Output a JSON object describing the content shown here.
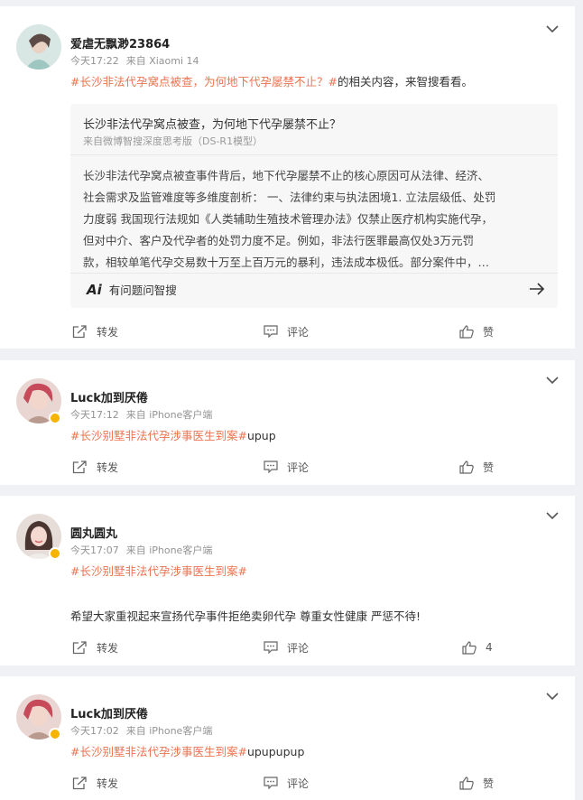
{
  "posts": [
    {
      "username": "爱虐无飘渺23864",
      "time": "今天17:22",
      "source": "来自 Xiaomi 14",
      "hashtag": "#长沙非法代孕窝点被查，为何地下代孕屡禁不止？#",
      "text_after_tag": "的相关内容，来智搜看看。",
      "ai_card": {
        "title": "长沙非法代孕窝点被查，为何地下代孕屡禁不止？",
        "subtitle": "来自微博智搜深度思考版（DS-R1模型）",
        "lines": [
          "长沙非法代孕窝点被查事件背后，地下代孕屡禁不止的核心原因可从法律、经济、",
          "社会需求及监管难度等多维度剖析： 一、法律约束与执法困境1. 立法层级低、处罚",
          "力度弱 我国现行法规如《人类辅助生殖技术管理办法》仅禁止医疗机构实施代孕，",
          "但对中介、客户及代孕者的处罚力度不足。例如，非法行医罪最高仅处3万元罚",
          "款，相较单笔代孕交易数十万至上百万元的暴利，违法成本极低。部分案件中，…"
        ],
        "ask_logo": "Ai",
        "ask_label": "有问题问智搜"
      },
      "repost": "转发",
      "comment": "评论",
      "like": "赞"
    },
    {
      "username": "Luck加到厌倦",
      "time": "今天17:12",
      "source": "来自 iPhone客户端",
      "hashtag": "#长沙别墅非法代孕涉事医生到案#",
      "text_after_tag": "upup",
      "repost": "转发",
      "comment": "评论",
      "like": "赞"
    },
    {
      "username": "圆丸圆丸",
      "time": "今天17:07",
      "source": "来自 iPhone客户端",
      "hashtag": "#长沙别墅非法代孕涉事医生到案#",
      "body": "希望大家重视起来宣扬代孕事件拒绝卖卵代孕 尊重女性健康 严惩不待!",
      "repost": "转发",
      "comment": "评论",
      "like": "4"
    },
    {
      "username": "Luck加到厌倦",
      "time": "今天17:02",
      "source": "来自 iPhone客户端",
      "hashtag": "#长沙别墅非法代孕涉事医生到案#",
      "text_after_tag": "upupupup",
      "repost": "转发",
      "comment": "评论",
      "like": "赞"
    }
  ],
  "colors": {
    "accent": "#eb7350",
    "verified": "#f6b300",
    "page_bg": "#f0f1f4"
  }
}
